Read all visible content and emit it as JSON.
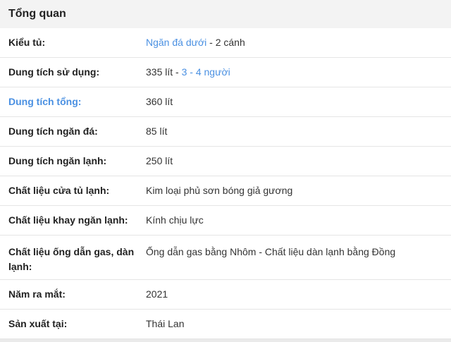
{
  "section": {
    "title": "Tổng quan"
  },
  "rows": [
    {
      "label": "Kiểu tủ:",
      "value_link": "Ngăn đá dưới",
      "value_rest": " - 2 cánh"
    },
    {
      "label": "Dung tích sử dụng:",
      "value_plain": "335 lít - ",
      "value_link": "3 - 4 người"
    },
    {
      "label": "Dung tích tổng:",
      "value": "360 lít"
    },
    {
      "label": "Dung tích ngăn đá:",
      "value": "85 lít"
    },
    {
      "label": "Dung tích ngăn lạnh:",
      "value": "250 lít"
    },
    {
      "label": "Chất liệu cửa tủ lạnh:",
      "value": "Kim loại phủ sơn bóng giả gương"
    },
    {
      "label": "Chất liệu khay ngăn lạnh:",
      "value": "Kính chịu lực"
    },
    {
      "label": "Chất liệu ống dẫn gas, dàn lạnh:",
      "value": "Ống dẫn gas bằng Nhôm - Chất liệu dàn lạnh bằng Đồng"
    },
    {
      "label": "Năm ra mắt:",
      "value": "2021"
    },
    {
      "label": "Sản xuất tại:",
      "value": "Thái Lan"
    }
  ],
  "colors": {
    "link": "#4a90e2",
    "header_bg": "#f3f3f3"
  }
}
